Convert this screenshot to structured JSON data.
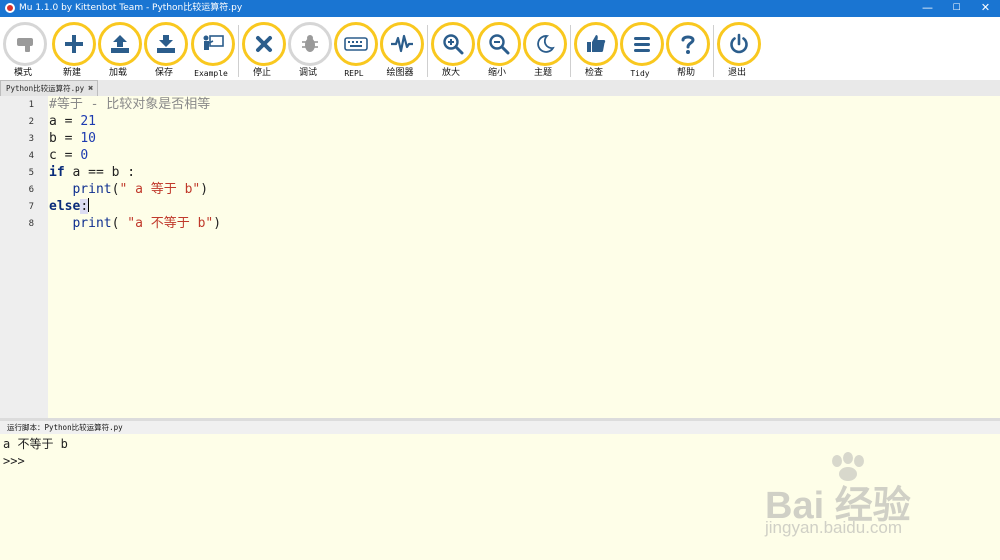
{
  "window": {
    "title": "Mu 1.1.0 by Kittenbot Team - Python比较运算符.py",
    "controls": {
      "minimize": "—",
      "maximize": "☐",
      "close": "✕"
    }
  },
  "colors": {
    "titlebar": "#1a75d2",
    "button_ring": "#f9c81f",
    "button_icon": "#2b5d8c",
    "editor_bg": "#fefee8",
    "gutter_bg": "#eeeeee"
  },
  "toolbar": {
    "buttons": [
      {
        "id": "mode",
        "label": "模式",
        "icon": "mode-icon",
        "enabled": false
      },
      {
        "id": "new",
        "label": "新建",
        "icon": "plus-icon",
        "enabled": true
      },
      {
        "id": "load",
        "label": "加载",
        "icon": "upload-icon",
        "enabled": true
      },
      {
        "id": "save",
        "label": "保存",
        "icon": "download-icon",
        "enabled": true
      },
      {
        "id": "example",
        "label": "Example",
        "icon": "presentation-icon",
        "enabled": true
      },
      {
        "id": "stop",
        "label": "停止",
        "icon": "close-icon",
        "enabled": true
      },
      {
        "id": "debug",
        "label": "调试",
        "icon": "bug-icon",
        "enabled": false
      },
      {
        "id": "repl",
        "label": "REPL",
        "icon": "keyboard-icon",
        "enabled": true
      },
      {
        "id": "plotter",
        "label": "绘图器",
        "icon": "pulse-icon",
        "enabled": true
      },
      {
        "id": "zoom-in",
        "label": "放大",
        "icon": "zoom-in-icon",
        "enabled": true
      },
      {
        "id": "zoom-out",
        "label": "缩小",
        "icon": "zoom-out-icon",
        "enabled": true
      },
      {
        "id": "theme",
        "label": "主题",
        "icon": "moon-icon",
        "enabled": true
      },
      {
        "id": "check",
        "label": "检查",
        "icon": "thumbs-up-icon",
        "enabled": true
      },
      {
        "id": "tidy",
        "label": "Tidy",
        "icon": "lines-icon",
        "enabled": true
      },
      {
        "id": "help",
        "label": "帮助",
        "icon": "question-icon",
        "enabled": true
      },
      {
        "id": "quit",
        "label": "退出",
        "icon": "power-icon",
        "enabled": true
      }
    ]
  },
  "tab": {
    "label": "Python比较运算符.py",
    "close": "✖"
  },
  "editor": {
    "line_numbers": [
      "1",
      "2",
      "3",
      "4",
      "5",
      "6",
      "7",
      "8"
    ],
    "lines": [
      [
        {
          "t": "#等于 - 比较对象是否相等",
          "c": "comment"
        }
      ],
      [
        {
          "t": "a = ",
          "c": "op"
        },
        {
          "t": "21",
          "c": "num"
        }
      ],
      [
        {
          "t": "b = ",
          "c": "op"
        },
        {
          "t": "10",
          "c": "num"
        }
      ],
      [
        {
          "t": "c = ",
          "c": "op"
        },
        {
          "t": "0",
          "c": "num"
        }
      ],
      [
        {
          "t": "if",
          "c": "kw"
        },
        {
          "t": " a == b :",
          "c": "op"
        }
      ],
      [
        {
          "t": "   ",
          "c": "op"
        },
        {
          "t": "print",
          "c": "fn"
        },
        {
          "t": "(",
          "c": "op"
        },
        {
          "t": "\" a 等于 b\"",
          "c": "str"
        },
        {
          "t": ")",
          "c": "op"
        }
      ],
      [
        {
          "t": "else",
          "c": "kw"
        },
        {
          "t": ":",
          "c": "hl"
        }
      ],
      [
        {
          "t": "   ",
          "c": "op"
        },
        {
          "t": "print",
          "c": "fn"
        },
        {
          "t": "( ",
          "c": "op"
        },
        {
          "t": "\"a 不等于 b\"",
          "c": "str"
        },
        {
          "t": ")",
          "c": "op"
        }
      ]
    ]
  },
  "status": {
    "run_label": "运行脚本：Python比较运算符.py"
  },
  "output": {
    "lines": [
      "a 不等于 b",
      ">>>"
    ]
  },
  "watermark": {
    "brand": "Bai 经验",
    "url": "jingyan.baidu.com"
  }
}
